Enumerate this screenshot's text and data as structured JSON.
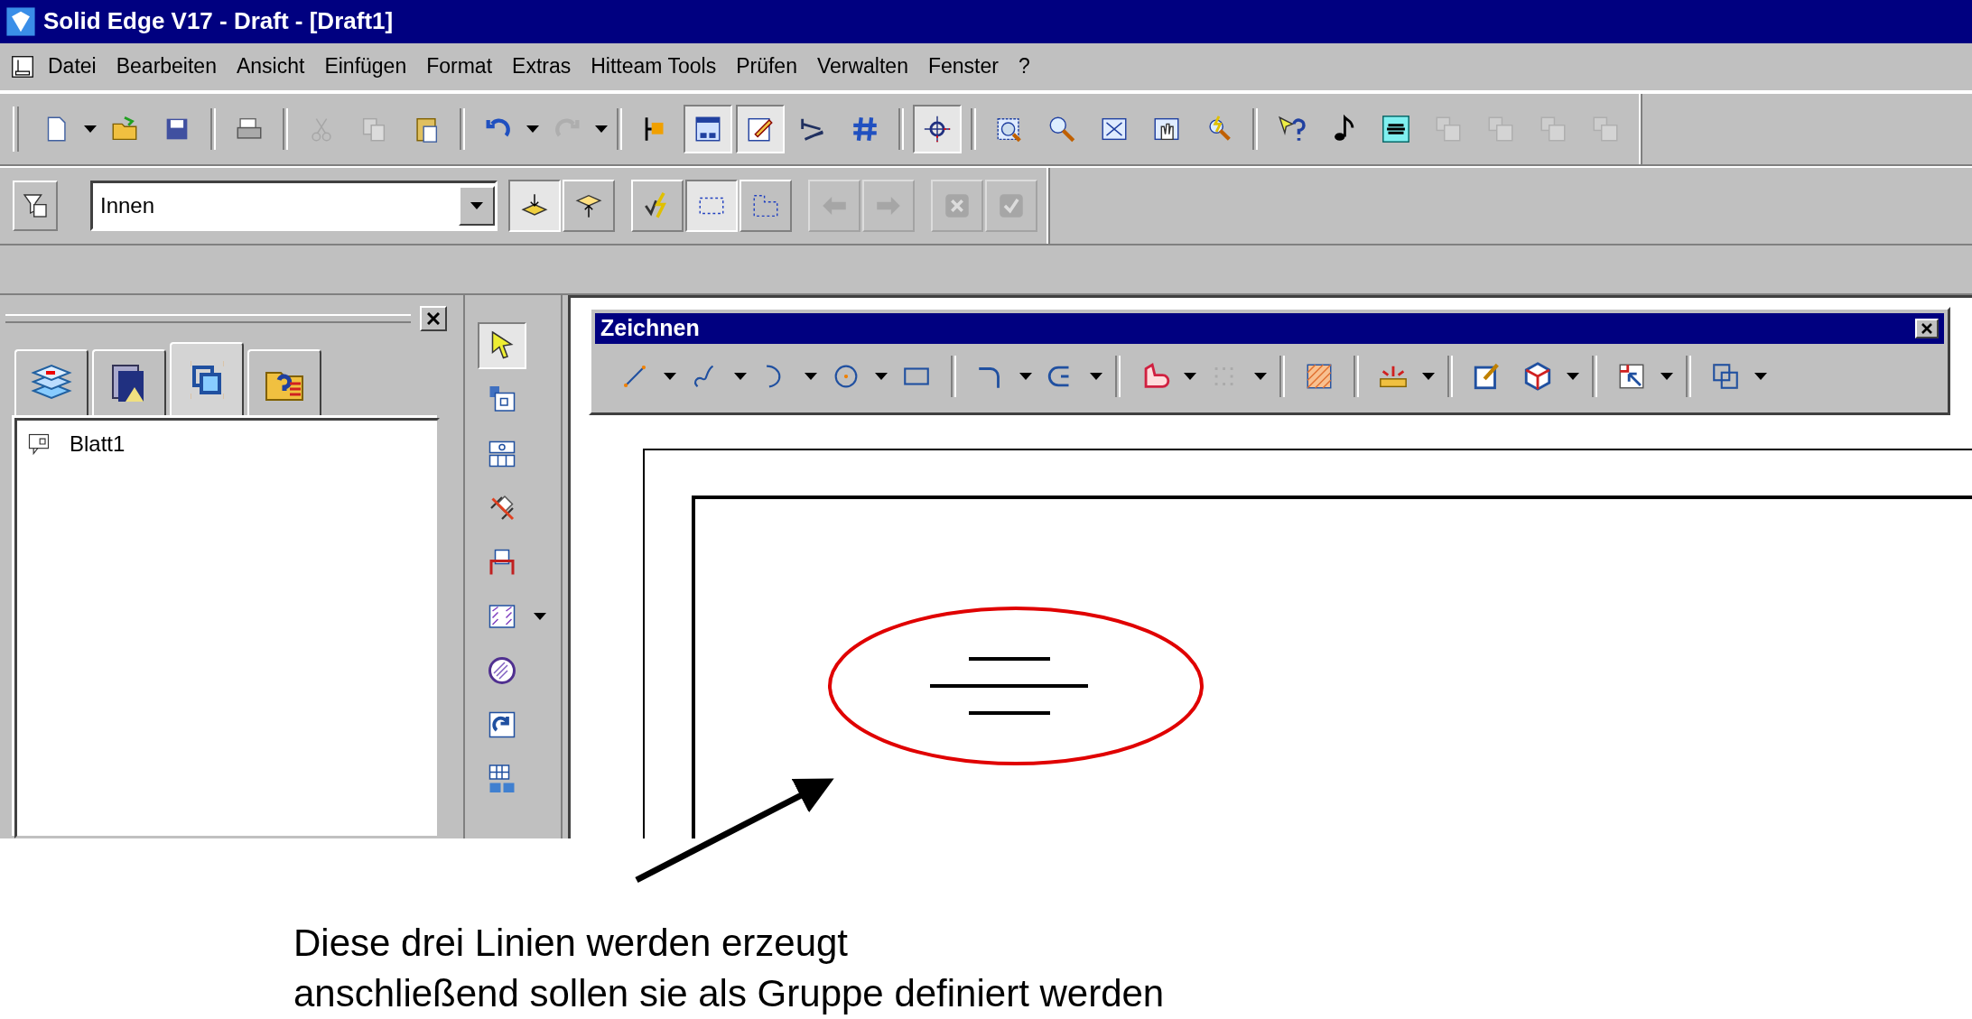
{
  "window": {
    "title": "Solid Edge V17 - Draft - [Draft1]"
  },
  "menu": [
    "Datei",
    "Bearbeiten",
    "Ansicht",
    "Einfügen",
    "Format",
    "Extras",
    "Hitteam Tools",
    "Prüfen",
    "Verwalten",
    "Fenster",
    "?"
  ],
  "standard_toolbar": [
    {
      "pressed": false,
      "disabled": false
    },
    {
      "pressed": false,
      "disabled": false
    },
    {
      "pressed": false,
      "disabled": false
    },
    {
      "pressed": false,
      "disabled": false
    },
    {
      "pressed": false,
      "disabled": true
    },
    {
      "pressed": false,
      "disabled": true
    },
    {
      "pressed": false,
      "disabled": false
    },
    {
      "pressed": false,
      "disabled": false
    },
    {
      "pressed": false,
      "disabled": true
    },
    {
      "pressed": false,
      "disabled": false
    },
    {
      "pressed": true,
      "disabled": false
    },
    {
      "pressed": true,
      "disabled": false
    },
    {
      "pressed": false,
      "disabled": false
    },
    {
      "pressed": false,
      "disabled": false
    },
    {
      "pressed": true,
      "disabled": false
    },
    {
      "pressed": false,
      "disabled": false
    },
    {
      "pressed": false,
      "disabled": false
    },
    {
      "pressed": false,
      "disabled": false
    },
    {
      "pressed": false,
      "disabled": false
    },
    {
      "pressed": false,
      "disabled": false
    },
    {
      "pressed": false,
      "disabled": false
    },
    {
      "pressed": false,
      "disabled": false
    },
    {
      "pressed": false,
      "disabled": false
    },
    {
      "pressed": false,
      "disabled": true
    },
    {
      "pressed": false,
      "disabled": true
    },
    {
      "pressed": false,
      "disabled": true
    },
    {
      "pressed": false,
      "disabled": true
    }
  ],
  "select_toolbar": {
    "combo_value": "Innen",
    "buttons": [
      {
        "pressed": true,
        "disabled": false
      },
      {
        "pressed": false,
        "disabled": false
      },
      {
        "pressed": false,
        "disabled": false
      },
      {
        "pressed": true,
        "disabled": false
      },
      {
        "pressed": false,
        "disabled": false
      },
      {
        "pressed": false,
        "disabled": true
      },
      {
        "pressed": false,
        "disabled": true
      },
      {
        "pressed": false,
        "disabled": true
      },
      {
        "pressed": false,
        "disabled": true
      }
    ]
  },
  "panel": {
    "tabs": [
      {
        "selected": false
      },
      {
        "selected": false
      },
      {
        "selected": true
      },
      {
        "selected": false
      }
    ],
    "tree": [
      {
        "label": "Blatt1"
      }
    ]
  },
  "side_toolbar": [
    {
      "pressed": true
    },
    {
      "pressed": false
    },
    {
      "pressed": false
    },
    {
      "pressed": false
    },
    {
      "pressed": false
    },
    {
      "pressed": false
    },
    {
      "pressed": false
    },
    {
      "pressed": false
    },
    {
      "pressed": false
    }
  ],
  "drawing_toolbar": {
    "title": "Zeichnen"
  },
  "annotation": {
    "lines": [
      "Diese drei Linien werden erzeugt",
      "anschließend sollen sie als Gruppe definiert werden"
    ]
  }
}
